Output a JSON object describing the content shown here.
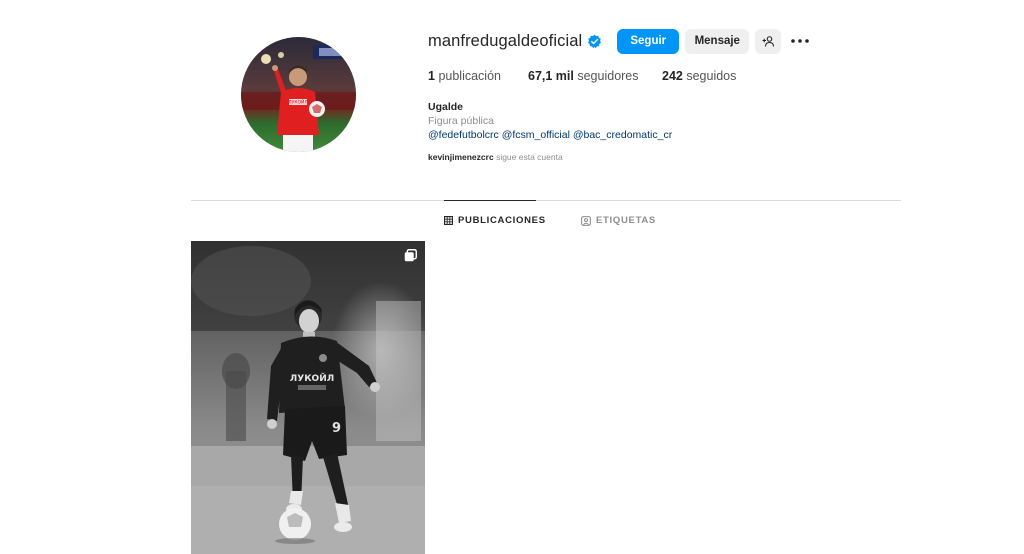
{
  "profile": {
    "username": "manfredugaldeoficial",
    "verified": true,
    "follow_label": "Seguir",
    "message_label": "Mensaje",
    "stats": {
      "posts_count": "1",
      "posts_label": "publicación",
      "followers_count": "67,1 mil",
      "followers_label": "seguidores",
      "following_count": "242",
      "following_label": "seguidos"
    },
    "bio": {
      "name": "Ugalde",
      "category": "Figura pública",
      "mentions": "@fedefutbolcrc @fcsm_official @bac_credomatic_cr"
    },
    "followed_by": {
      "user": "kevinjimenezcrc",
      "text": "sigue esta cuenta"
    }
  },
  "tabs": [
    {
      "label": "PUBLICACIONES",
      "icon": "grid-icon",
      "active": true
    },
    {
      "label": "ETIQUETAS",
      "icon": "tagged-icon",
      "active": false
    }
  ],
  "post": {
    "jersey_sponsor": "ЛУКОЙЛ",
    "jersey_number": "9",
    "multi_icon": "carousel-icon"
  },
  "avatar": {
    "jersey_sponsor": "ЛУКОЙЛ"
  },
  "colors": {
    "accent": "#0095f6",
    "verified": "#0095f6",
    "link": "#00376b",
    "secondary_text": "#8e8e8e"
  }
}
